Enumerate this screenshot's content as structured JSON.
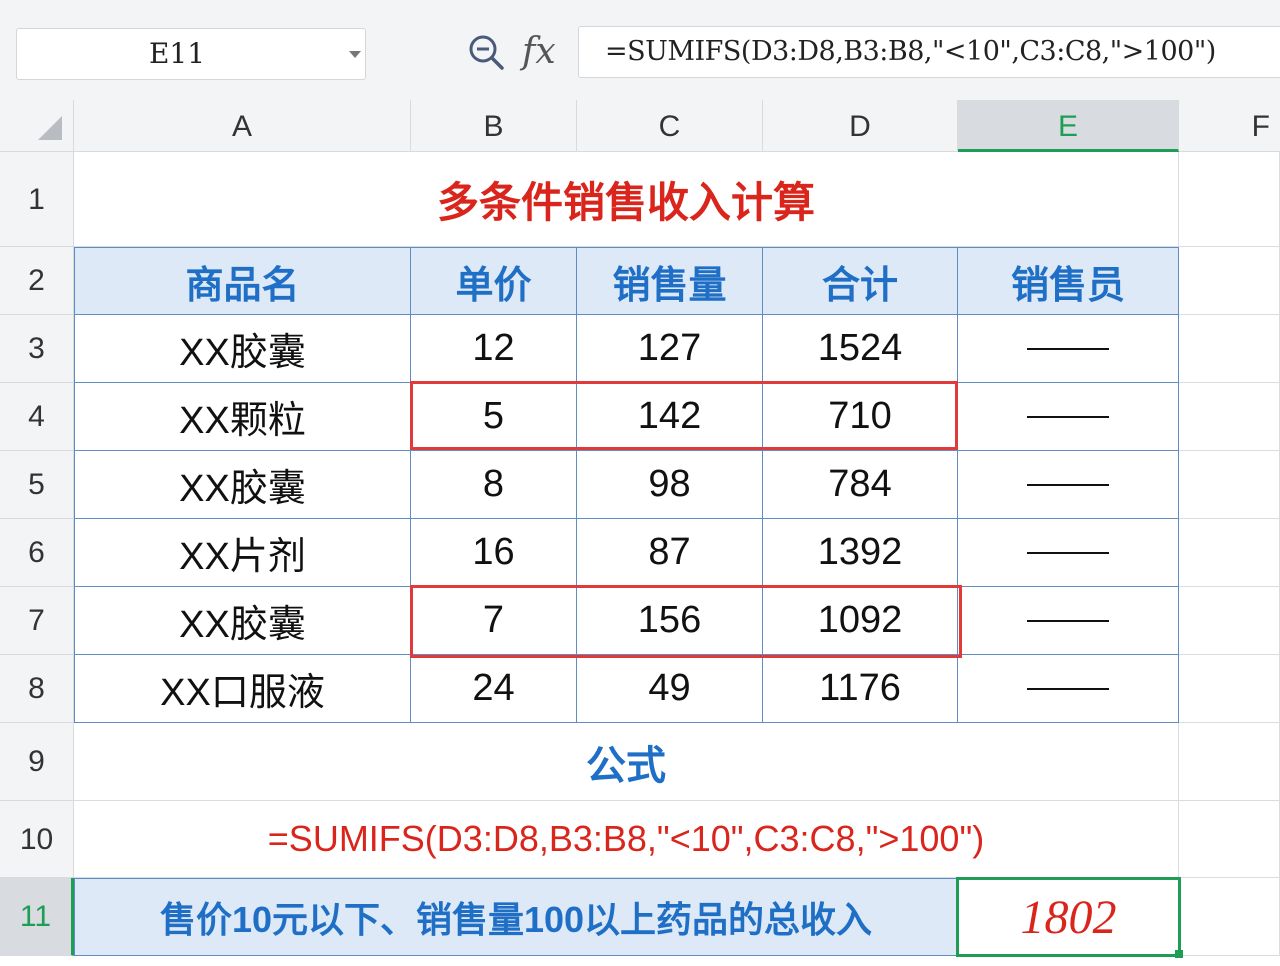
{
  "formula_bar": {
    "name_box": "E11",
    "fx_label": "fx",
    "formula": "=SUMIFS(D3:D8,B3:B8,\"<10\",C3:C8,\">100\")"
  },
  "columns": [
    "A",
    "B",
    "C",
    "D",
    "E",
    "F"
  ],
  "rows": [
    "1",
    "2",
    "3",
    "4",
    "5",
    "6",
    "7",
    "8",
    "9",
    "10",
    "11"
  ],
  "sheet": {
    "title": "多条件销售收入计算",
    "headers": [
      "商品名",
      "单价",
      "销售量",
      "合计",
      "销售员"
    ],
    "data_rows": [
      {
        "name": "XX胶囊",
        "price": "12",
        "qty": "127",
        "total": "1524",
        "seller": "——"
      },
      {
        "name": "XX颗粒",
        "price": "5",
        "qty": "142",
        "total": "710",
        "seller": "——"
      },
      {
        "name": "XX胶囊",
        "price": "8",
        "qty": "98",
        "total": "784",
        "seller": "——"
      },
      {
        "name": "XX片剂",
        "price": "16",
        "qty": "87",
        "total": "1392",
        "seller": "——"
      },
      {
        "name": "XX胶囊",
        "price": "7",
        "qty": "156",
        "total": "1092",
        "seller": "——"
      },
      {
        "name": "XX口服液",
        "price": "24",
        "qty": "49",
        "total": "1176",
        "seller": "——"
      }
    ],
    "formula_heading": "公式",
    "formula_text": "=SUMIFS(D3:D8,B3:B8,\"<10\",C3:C8,\">100\")",
    "summary_label": "售价10元以下、销售量100以上药品的总收入",
    "summary_value": "1802"
  },
  "colors": {
    "header_fill": "#dde9f6",
    "header_text": "#1f6fc6",
    "title_red": "#d9251c",
    "highlight_red": "#e03a3a",
    "selection_green": "#1e9e55"
  }
}
